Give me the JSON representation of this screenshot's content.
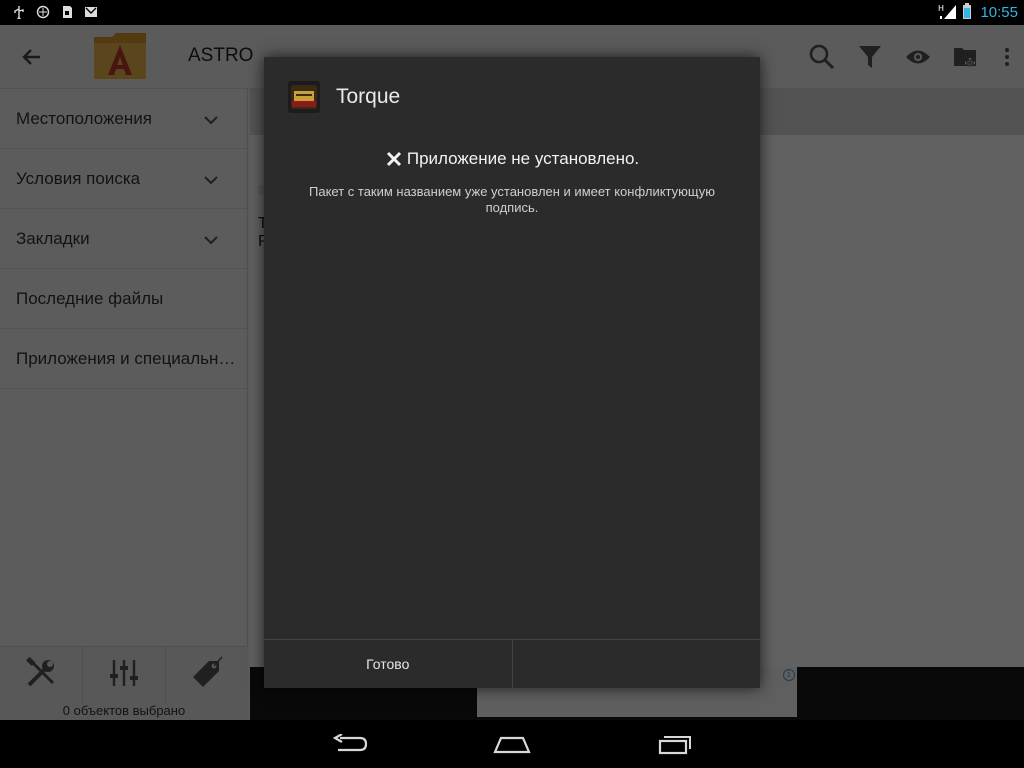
{
  "status_bar": {
    "time": "10:55",
    "left_icons": [
      "usb-icon",
      "sync-icon",
      "sd-card-icon",
      "gmail-icon"
    ],
    "right_icons": [
      "hplus-signal-icon",
      "battery-icon"
    ],
    "accent": "#33b5e5"
  },
  "app": {
    "title": "ASTRO",
    "action_icons": [
      "search-icon",
      "filter-icon",
      "eye-icon",
      "new-folder-icon",
      "overflow-menu-icon"
    ],
    "sidebar": {
      "items": [
        {
          "label": "Местоположения",
          "expandable": true
        },
        {
          "label": "Условия поиска",
          "expandable": true
        },
        {
          "label": "Закладки",
          "expandable": true
        },
        {
          "label": "Последние файлы",
          "expandable": false
        },
        {
          "label": "Приложения и специальные",
          "expandable": false
        }
      ],
      "tools": [
        "tools-icon",
        "equalizer-icon",
        "tag-icon"
      ],
      "selected_count": "0 объектов выбрано"
    },
    "content_text": "Т Р"
  },
  "dialog": {
    "title": "Torque",
    "status": "Приложение не установлено.",
    "message": "Пакет с таким названием уже установлен и имеет конфликтующую подпись.",
    "button_done": "Готово",
    "button_other": ""
  },
  "nav": {
    "buttons": [
      "back-icon",
      "home-icon",
      "recent-apps-icon"
    ]
  }
}
